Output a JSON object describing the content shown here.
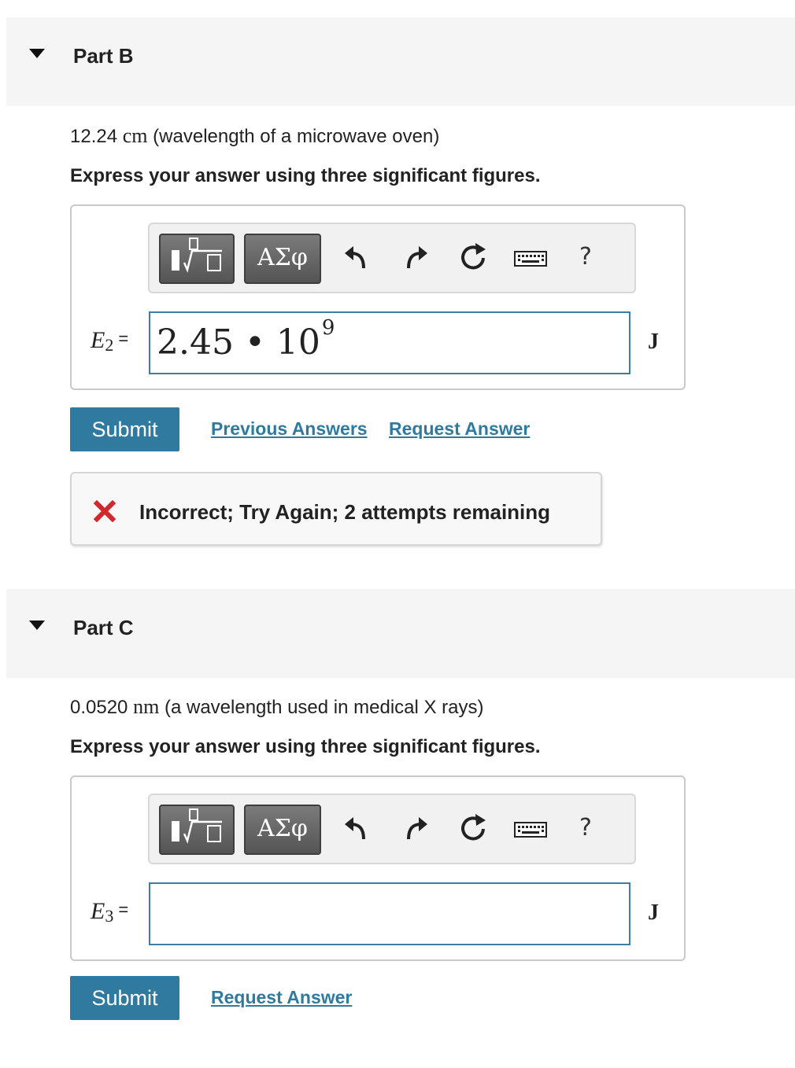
{
  "partB": {
    "title": "Part B",
    "prompt_value": "12.24",
    "prompt_unit": "cm",
    "prompt_desc": "(wavelength of a microwave oven)",
    "instruction": "Express your answer using three significant figures.",
    "toolbar": {
      "greek_label": "ΑΣφ",
      "help_label": "?"
    },
    "var_symbol": "E",
    "var_sub": "2",
    "var_eq": "=",
    "input_mantissa": "2.45 • 10",
    "input_exponent": "9",
    "unit": "J",
    "submit_label": "Submit",
    "previous_answers_label": "Previous Answers",
    "request_answer_label": "Request Answer",
    "feedback": "Incorrect; Try Again; 2 attempts remaining",
    "feedback_color": "#d0282e"
  },
  "partC": {
    "title": "Part C",
    "prompt_value": "0.0520",
    "prompt_unit": "nm",
    "prompt_desc": "(a wavelength used in medical X rays)",
    "instruction": "Express your answer using three significant figures.",
    "toolbar": {
      "greek_label": "ΑΣφ",
      "help_label": "?"
    },
    "var_symbol": "E",
    "var_sub": "3",
    "var_eq": "=",
    "input_value": "",
    "unit": "J",
    "submit_label": "Submit",
    "request_answer_label": "Request Answer"
  },
  "colors": {
    "accent": "#2f7a9e",
    "header_bg": "#f5f5f5",
    "input_border": "#3e7d9c"
  },
  "icons": [
    "collapse-triangle-icon",
    "template-icon",
    "undo-icon",
    "redo-icon",
    "reset-icon",
    "keyboard-icon",
    "help-icon",
    "incorrect-x-icon"
  ]
}
